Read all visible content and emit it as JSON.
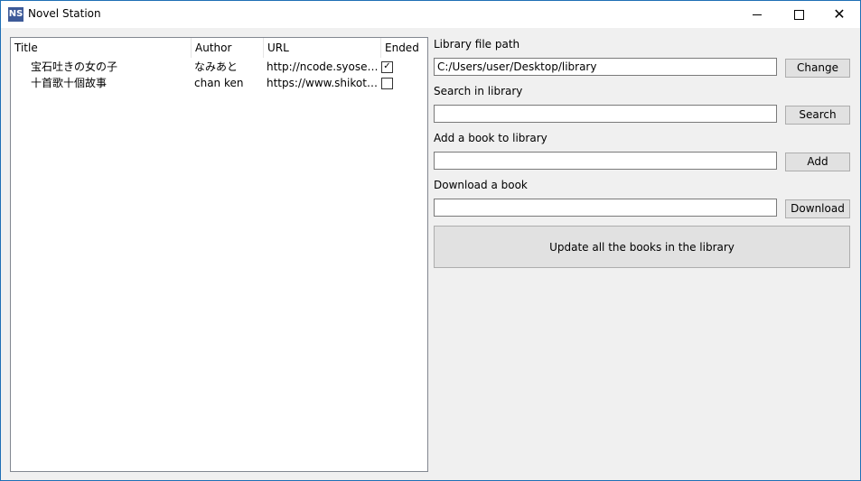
{
  "window": {
    "icon_text": "NS",
    "title": "Novel Station"
  },
  "table": {
    "columns": [
      "Title",
      "Author",
      "URL",
      "Ended"
    ],
    "rows": [
      {
        "title": "宝石吐きの女の子",
        "author": "なみあと",
        "url": "http://ncode.syosetu....",
        "ended": true
      },
      {
        "title": "十首歌十個故事",
        "author": "chan ken",
        "url": "https://www.shikoto....",
        "ended": false
      }
    ]
  },
  "library": {
    "path_label": "Library file path",
    "path_value": "C:/Users/user/Desktop/library",
    "change_label": "Change"
  },
  "search": {
    "label": "Search in library",
    "value": "",
    "button_label": "Search"
  },
  "add": {
    "label": "Add a book to library",
    "value": "",
    "button_label": "Add"
  },
  "download": {
    "label": "Download a book",
    "value": "",
    "button_label": "Download"
  },
  "update_label": "Update all the books in the library"
}
